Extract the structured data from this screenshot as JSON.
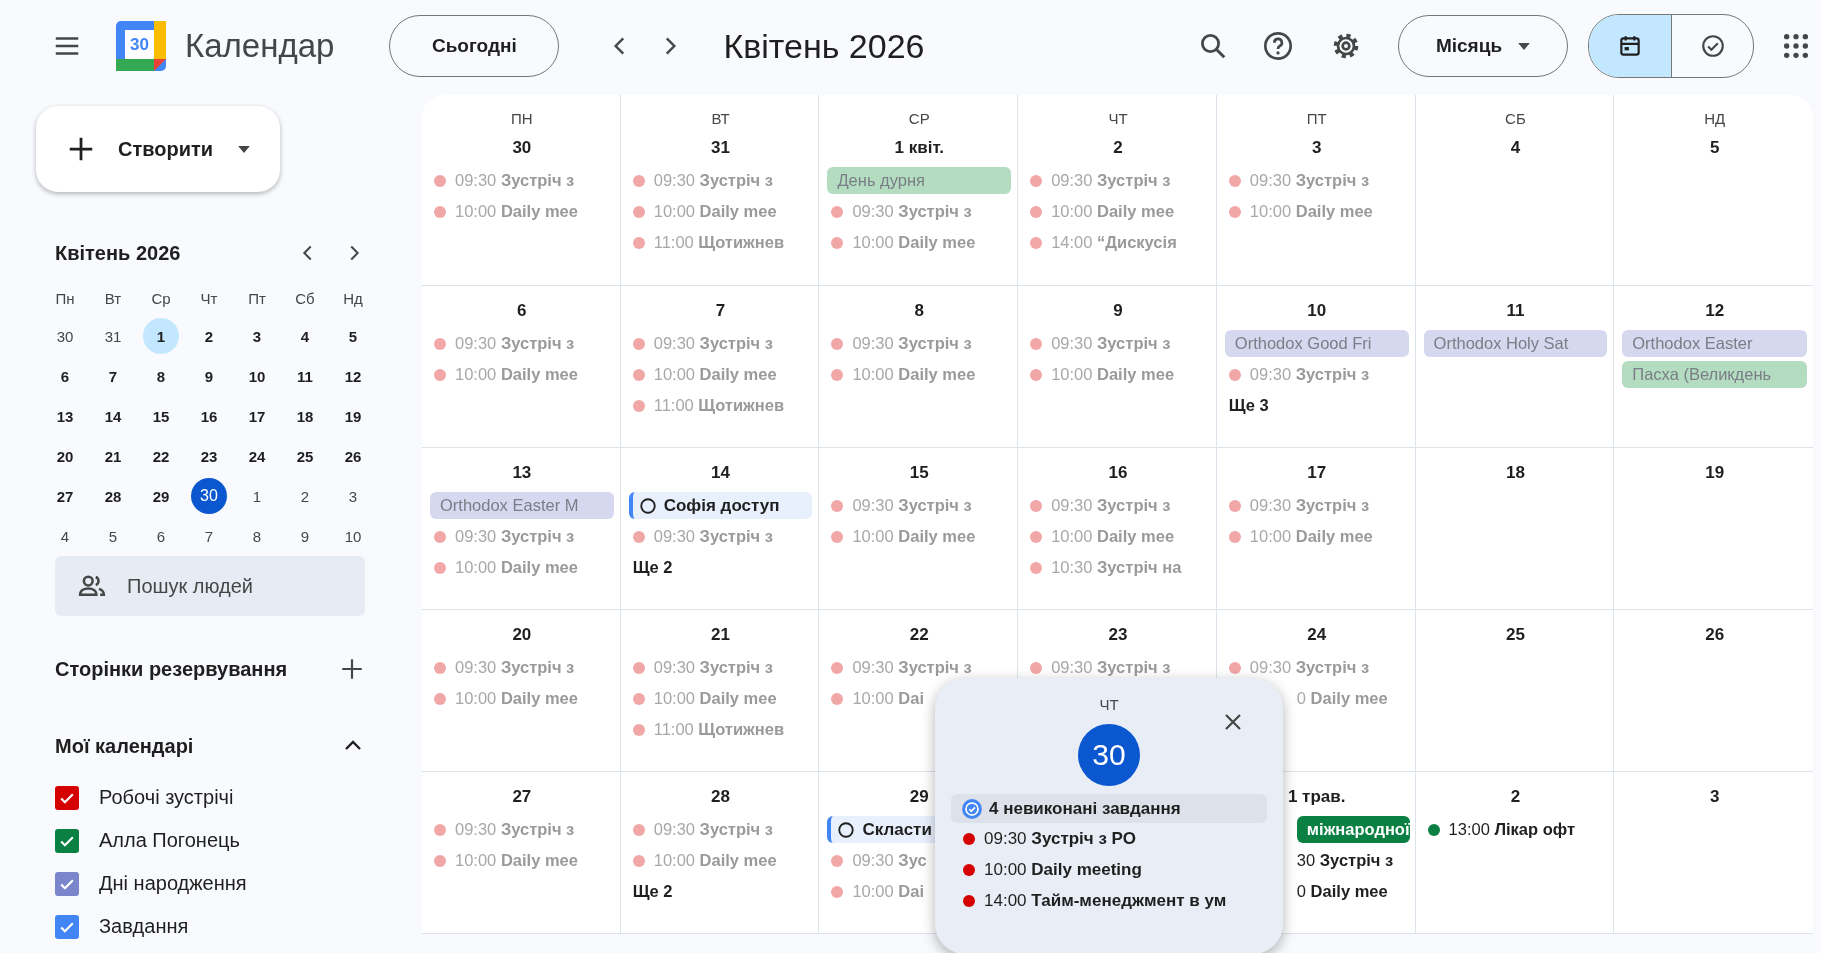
{
  "topbar": {
    "app_name": "Календар",
    "logo_text": "30",
    "today_button": "Сьогодні",
    "period": "Квітень 2026",
    "view_select": "Місяць",
    "view_modes": [
      {
        "kind": "calendar",
        "selected": true
      },
      {
        "kind": "tasks",
        "selected": false
      }
    ]
  },
  "sidebar": {
    "create_button": "Створити",
    "mini_calendar": {
      "title": "Квітень 2026",
      "weekdays": [
        "Пн",
        "Вт",
        "Ср",
        "Чт",
        "Пт",
        "Сб",
        "Нд"
      ],
      "weeks": [
        [
          {
            "d": "30",
            "out": true,
            "selected": false
          },
          {
            "d": "31",
            "out": true,
            "selected": false
          },
          {
            "d": "1",
            "out": false,
            "selected": true
          },
          {
            "d": "2",
            "out": false,
            "selected": false
          },
          {
            "d": "3",
            "out": false,
            "selected": false
          },
          {
            "d": "4",
            "out": false,
            "selected": false
          },
          {
            "d": "5",
            "out": false,
            "selected": false
          }
        ],
        [
          {
            "d": "6",
            "out": false,
            "selected": false
          },
          {
            "d": "7",
            "out": false,
            "selected": false
          },
          {
            "d": "8",
            "out": false,
            "selected": false
          },
          {
            "d": "9",
            "out": false,
            "selected": false
          },
          {
            "d": "10",
            "out": false,
            "selected": false
          },
          {
            "d": "11",
            "out": false,
            "selected": false
          },
          {
            "d": "12",
            "out": false,
            "selected": false
          }
        ],
        [
          {
            "d": "13",
            "out": false,
            "selected": false
          },
          {
            "d": "14",
            "out": false,
            "selected": false
          },
          {
            "d": "15",
            "out": false,
            "selected": false
          },
          {
            "d": "16",
            "out": false,
            "selected": false
          },
          {
            "d": "17",
            "out": false,
            "selected": false
          },
          {
            "d": "18",
            "out": false,
            "selected": false
          },
          {
            "d": "19",
            "out": false,
            "selected": false
          }
        ],
        [
          {
            "d": "20",
            "out": false,
            "selected": false
          },
          {
            "d": "21",
            "out": false,
            "selected": false
          },
          {
            "d": "22",
            "out": false,
            "selected": false
          },
          {
            "d": "23",
            "out": false,
            "selected": false
          },
          {
            "d": "24",
            "out": false,
            "selected": false
          },
          {
            "d": "25",
            "out": false,
            "selected": false
          },
          {
            "d": "26",
            "out": false,
            "selected": false
          }
        ],
        [
          {
            "d": "27",
            "out": false,
            "selected": false
          },
          {
            "d": "28",
            "out": false,
            "selected": false
          },
          {
            "d": "29",
            "out": false,
            "selected": false
          },
          {
            "d": "30",
            "out": false,
            "selected": false,
            "today": true
          },
          {
            "d": "1",
            "out": true,
            "selected": false
          },
          {
            "d": "2",
            "out": true,
            "selected": false
          },
          {
            "d": "3",
            "out": true,
            "selected": false
          }
        ],
        [
          {
            "d": "4",
            "out": true,
            "selected": false
          },
          {
            "d": "5",
            "out": true,
            "selected": false
          },
          {
            "d": "6",
            "out": true,
            "selected": false
          },
          {
            "d": "7",
            "out": true,
            "selected": false
          },
          {
            "d": "8",
            "out": true,
            "selected": false
          },
          {
            "d": "9",
            "out": true,
            "selected": false
          },
          {
            "d": "10",
            "out": true,
            "selected": false
          }
        ]
      ]
    },
    "people_search": {
      "placeholder": "Пошук людей"
    },
    "booking_pages": "Сторінки резервування",
    "my_calendars": {
      "title": "Мої календарі",
      "expanded": true,
      "items": [
        {
          "name": "Робочі зустрічі",
          "checked": true,
          "color": "#d50000"
        },
        {
          "name": "Алла Погонець",
          "checked": true,
          "color": "#0b8043"
        },
        {
          "name": "Дні народження",
          "checked": true,
          "color": "#7986cb"
        },
        {
          "name": "Завдання",
          "checked": true,
          "color": "#4285f4"
        }
      ]
    }
  },
  "calendar": {
    "weekdays": [
      "ПН",
      "ВТ",
      "СР",
      "ЧТ",
      "ПТ",
      "СБ",
      "НД"
    ],
    "weeks": [
      [
        {
          "date": "30",
          "events": [
            {
              "kind": "timed",
              "time": "09:30",
              "title": "Зустріч з",
              "color": "#f2a7a7",
              "past": true
            },
            {
              "kind": "timed",
              "time": "10:00",
              "title": "Daily mee",
              "color": "#f2a7a7",
              "past": true
            }
          ]
        },
        {
          "date": "31",
          "events": [
            {
              "kind": "timed",
              "time": "09:30",
              "title": "Зустріч з",
              "color": "#f2a7a7",
              "past": true
            },
            {
              "kind": "timed",
              "time": "10:00",
              "title": "Daily mee",
              "color": "#f2a7a7",
              "past": true
            },
            {
              "kind": "timed",
              "time": "11:00",
              "title": "Щотижнев",
              "color": "#f2a7a7",
              "past": true
            }
          ]
        },
        {
          "date": "1 квіт.",
          "events": [
            {
              "kind": "allday",
              "title": "День дурня",
              "color": "#b3dcc0",
              "past": true
            },
            {
              "kind": "timed",
              "time": "09:30",
              "title": "Зустріч з",
              "color": "#f2a7a7",
              "past": true
            },
            {
              "kind": "timed",
              "time": "10:00",
              "title": "Daily mee",
              "color": "#f2a7a7",
              "past": true
            }
          ]
        },
        {
          "date": "2",
          "events": [
            {
              "kind": "timed",
              "time": "09:30",
              "title": "Зустріч з",
              "color": "#f2a7a7",
              "past": true
            },
            {
              "kind": "timed",
              "time": "10:00",
              "title": "Daily mee",
              "color": "#f2a7a7",
              "past": true
            },
            {
              "kind": "timed",
              "time": "14:00",
              "title": "“Дискусія",
              "color": "#f2a7a7",
              "past": true
            }
          ]
        },
        {
          "date": "3",
          "events": [
            {
              "kind": "timed",
              "time": "09:30",
              "title": "Зустріч з",
              "color": "#f2a7a7",
              "past": true
            },
            {
              "kind": "timed",
              "time": "10:00",
              "title": "Daily mee",
              "color": "#f2a7a7",
              "past": true
            }
          ]
        },
        {
          "date": "4"
        },
        {
          "date": "5"
        }
      ],
      [
        {
          "date": "6",
          "events": [
            {
              "kind": "timed",
              "time": "09:30",
              "title": "Зустріч з",
              "color": "#f2a7a7",
              "past": true
            },
            {
              "kind": "timed",
              "time": "10:00",
              "title": "Daily mee",
              "color": "#f2a7a7",
              "past": true
            }
          ]
        },
        {
          "date": "7",
          "events": [
            {
              "kind": "timed",
              "time": "09:30",
              "title": "Зустріч з",
              "color": "#f2a7a7",
              "past": true
            },
            {
              "kind": "timed",
              "time": "10:00",
              "title": "Daily mee",
              "color": "#f2a7a7",
              "past": true
            },
            {
              "kind": "timed",
              "time": "11:00",
              "title": "Щотижнев",
              "color": "#f2a7a7",
              "past": true
            }
          ]
        },
        {
          "date": "8",
          "events": [
            {
              "kind": "timed",
              "time": "09:30",
              "title": "Зустріч з",
              "color": "#f2a7a7",
              "past": true
            },
            {
              "kind": "timed",
              "time": "10:00",
              "title": "Daily mee",
              "color": "#f2a7a7",
              "past": true
            }
          ]
        },
        {
          "date": "9",
          "events": [
            {
              "kind": "timed",
              "time": "09:30",
              "title": "Зустріч з",
              "color": "#f2a7a7",
              "past": true
            },
            {
              "kind": "timed",
              "time": "10:00",
              "title": "Daily mee",
              "color": "#f2a7a7",
              "past": true
            }
          ]
        },
        {
          "date": "10",
          "events": [
            {
              "kind": "allday",
              "title": "Orthodox Good Fri",
              "color": "#d5d8ef",
              "past": true
            },
            {
              "kind": "timed",
              "time": "09:30",
              "title": "Зустріч з",
              "color": "#f2a7a7",
              "past": true
            },
            {
              "kind": "more",
              "title": "Ще 3"
            }
          ]
        },
        {
          "date": "11",
          "events": [
            {
              "kind": "allday",
              "title": "Orthodox Holy Sat",
              "color": "#d5d8ef",
              "past": true
            }
          ]
        },
        {
          "date": "12",
          "events": [
            {
              "kind": "allday",
              "title": "Orthodox Easter",
              "color": "#d5d8ef",
              "past": true
            },
            {
              "kind": "allday",
              "title": "Пасха (Великдень",
              "color": "#b3dcc0",
              "past": true
            }
          ]
        }
      ],
      [
        {
          "date": "13",
          "events": [
            {
              "kind": "allday",
              "title": "Orthodox Easter M",
              "color": "#d5d8ef",
              "past": true
            },
            {
              "kind": "timed",
              "time": "09:30",
              "title": "Зустріч з",
              "color": "#f2a7a7",
              "past": true
            },
            {
              "kind": "timed",
              "time": "10:00",
              "title": "Daily mee",
              "color": "#f2a7a7",
              "past": true
            }
          ]
        },
        {
          "date": "14",
          "events": [
            {
              "kind": "task",
              "title": "Софія доступ"
            },
            {
              "kind": "timed",
              "time": "09:30",
              "title": "Зустріч з",
              "color": "#f2a7a7",
              "past": true
            },
            {
              "kind": "more",
              "title": "Ще 2"
            }
          ]
        },
        {
          "date": "15",
          "events": [
            {
              "kind": "timed",
              "time": "09:30",
              "title": "Зустріч з",
              "color": "#f2a7a7",
              "past": true
            },
            {
              "kind": "timed",
              "time": "10:00",
              "title": "Daily mee",
              "color": "#f2a7a7",
              "past": true
            }
          ]
        },
        {
          "date": "16",
          "events": [
            {
              "kind": "timed",
              "time": "09:30",
              "title": "Зустріч з",
              "color": "#f2a7a7",
              "past": true
            },
            {
              "kind": "timed",
              "time": "10:00",
              "title": "Daily mee",
              "color": "#f2a7a7",
              "past": true
            },
            {
              "kind": "timed",
              "time": "10:30",
              "title": "Зустріч на",
              "color": "#f2a7a7",
              "past": true
            }
          ]
        },
        {
          "date": "17",
          "events": [
            {
              "kind": "timed",
              "time": "09:30",
              "title": "Зустріч з",
              "color": "#f2a7a7",
              "past": true
            },
            {
              "kind": "timed",
              "time": "10:00",
              "title": "Daily mee",
              "color": "#f2a7a7",
              "past": true
            }
          ]
        },
        {
          "date": "18"
        },
        {
          "date": "19"
        }
      ],
      [
        {
          "date": "20",
          "events": [
            {
              "kind": "timed",
              "time": "09:30",
              "title": "Зустріч з",
              "color": "#f2a7a7",
              "past": true
            },
            {
              "kind": "timed",
              "time": "10:00",
              "title": "Daily mee",
              "color": "#f2a7a7",
              "past": true
            }
          ]
        },
        {
          "date": "21",
          "events": [
            {
              "kind": "timed",
              "time": "09:30",
              "title": "Зустріч з",
              "color": "#f2a7a7",
              "past": true
            },
            {
              "kind": "timed",
              "time": "10:00",
              "title": "Daily mee",
              "color": "#f2a7a7",
              "past": true
            },
            {
              "kind": "timed",
              "time": "11:00",
              "title": "Щотижнев",
              "color": "#f2a7a7",
              "past": true
            }
          ]
        },
        {
          "date": "22",
          "events": [
            {
              "kind": "timed",
              "time": "09:30",
              "title": "Зустріч з",
              "color": "#f2a7a7",
              "past": true
            },
            {
              "kind": "timed",
              "time": "10:00",
              "title": "Dai",
              "color": "#f2a7a7",
              "past": true
            }
          ]
        },
        {
          "date": "23",
          "events": [
            {
              "kind": "timed",
              "time": "09:30",
              "title": "Зустріч з",
              "color": "#f2a7a7",
              "past": true
            }
          ]
        },
        {
          "date": "24",
          "events": [
            {
              "kind": "timed",
              "time": "09:30",
              "title": "Зустріч з",
              "color": "#f2a7a7",
              "past": true
            },
            {
              "kind": "timed",
              "time": "0",
              "title": "Daily mee",
              "past": true,
              "cut": true
            }
          ]
        },
        {
          "date": "25"
        },
        {
          "date": "26"
        }
      ],
      [
        {
          "date": "27",
          "events": [
            {
              "kind": "timed",
              "time": "09:30",
              "title": "Зустріч з",
              "color": "#f2a7a7",
              "past": true
            },
            {
              "kind": "timed",
              "time": "10:00",
              "title": "Daily mee",
              "color": "#f2a7a7",
              "past": true
            }
          ]
        },
        {
          "date": "28",
          "events": [
            {
              "kind": "timed",
              "time": "09:30",
              "title": "Зустріч з",
              "color": "#f2a7a7",
              "past": true
            },
            {
              "kind": "timed",
              "time": "10:00",
              "title": "Daily mee",
              "color": "#f2a7a7",
              "past": true
            },
            {
              "kind": "more",
              "title": "Ще 2"
            }
          ]
        },
        {
          "date": "29",
          "events": [
            {
              "kind": "task",
              "title": "Скласти"
            },
            {
              "kind": "timed",
              "time": "09:30",
              "title": "Зус",
              "color": "#f2a7a7",
              "past": true
            },
            {
              "kind": "timed",
              "time": "10:00",
              "title": "Dai",
              "color": "#f2a7a7",
              "past": true
            }
          ]
        },
        {
          "popup": {
            "weekday": "ЧТ",
            "day": "30",
            "items": [
              {
                "kind": "tasks",
                "title": "4 невиконані завдання"
              },
              {
                "kind": "timed",
                "time": "09:30",
                "title": "Зустріч з РО",
                "color": "#d50000"
              },
              {
                "kind": "timed",
                "time": "10:00",
                "title": "Daily meeting",
                "color": "#d50000"
              },
              {
                "kind": "timed",
                "time": "14:00",
                "title": "Тайм-менеджмент в ум",
                "color": "#d50000"
              }
            ]
          }
        },
        {
          "date": "1 трав.",
          "events": [
            {
              "kind": "allday",
              "title": "міжнародної",
              "color": "#0b8043",
              "past": false,
              "cut": true
            },
            {
              "kind": "timed",
              "time": "30",
              "title": "Зустріч з",
              "past": false,
              "cut": true
            },
            {
              "kind": "timed",
              "time": "0",
              "title": "Daily mee",
              "past": false,
              "cut": true
            }
          ]
        },
        {
          "date": "2",
          "events": [
            {
              "kind": "timed",
              "time": "13:00",
              "title": "Лікар офт",
              "color": "#0b8043",
              "past": false
            }
          ]
        },
        {
          "date": "3"
        }
      ]
    ]
  }
}
